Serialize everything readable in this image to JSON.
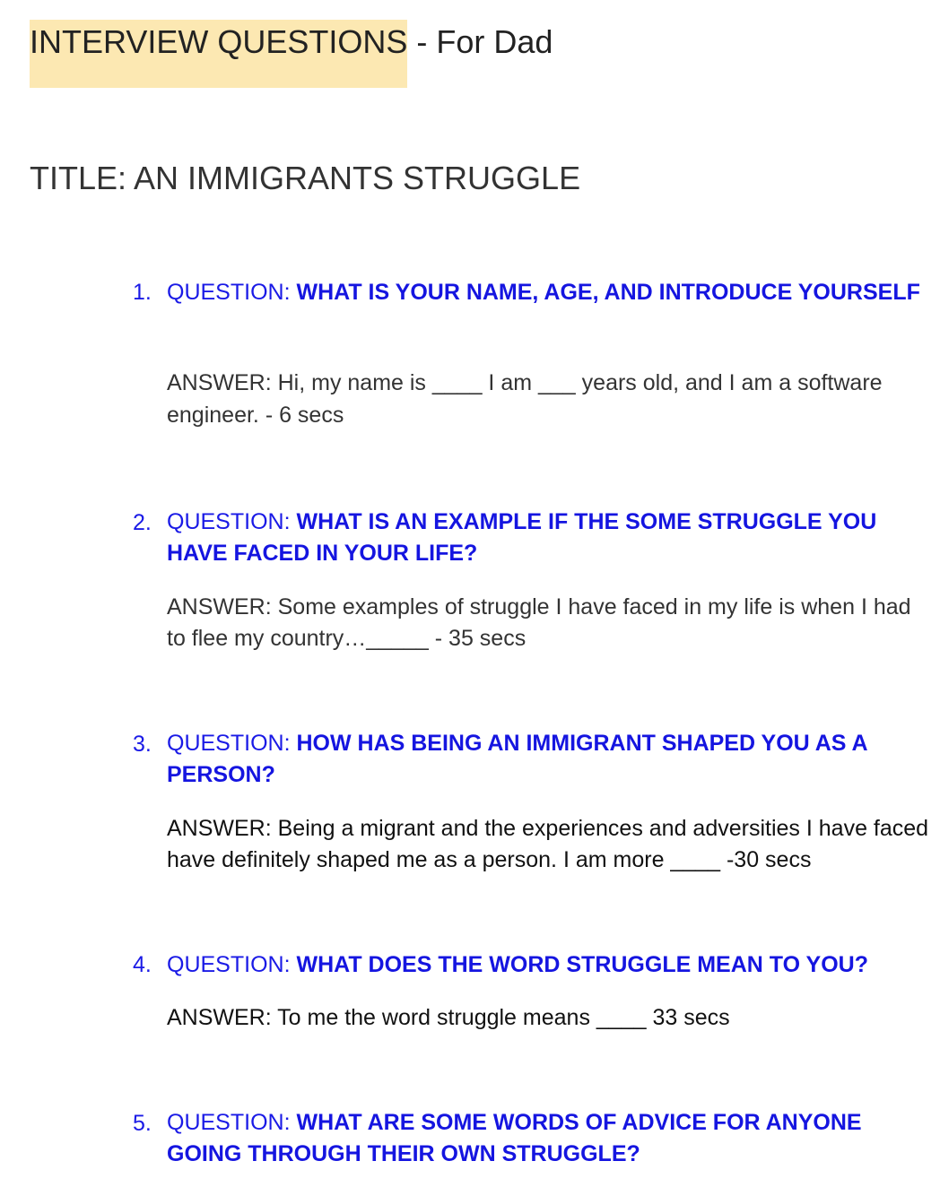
{
  "header": {
    "highlighted": "INTERVIEW QUESTIONS",
    "rest": " - For Dad"
  },
  "title": "TITLE: AN IMMIGRANTS STRUGGLE",
  "questions": [
    {
      "number": "1.",
      "lead": "QUESTION: ",
      "question": "WHAT IS YOUR NAME, AGE, AND INTRODUCE YOURSELF",
      "answer": "ANSWER: Hi, my name is ____ I am ___ years old, and I am a software engineer. - 6 secs"
    },
    {
      "number": "2.",
      "lead": "QUESTION: ",
      "question": "WHAT IS AN EXAMPLE IF THE SOME STRUGGLE YOU HAVE FACED IN YOUR LIFE?",
      "answer": "ANSWER: Some examples of struggle I have faced in my life is when I had to flee my country…_____ - 35 secs"
    },
    {
      "number": "3.",
      "lead": "QUESTION: ",
      "question": "HOW HAS BEING AN IMMIGRANT SHAPED YOU AS A PERSON?",
      "answer": "ANSWER: Being a migrant and the experiences and adversities I have faced have definitely shaped me as a person. I am more ____ -30 secs"
    },
    {
      "number": "4.",
      "lead": "QUESTION: ",
      "question": "WHAT DOES THE WORD STRUGGLE MEAN TO YOU?",
      "answer": "ANSWER: To me the word struggle means ____ 33 secs"
    },
    {
      "number": "5.",
      "lead": "QUESTION: ",
      "question": "WHAT ARE SOME WORDS OF ADVICE FOR ANYONE GOING THROUGH THEIR OWN STRUGGLE?"
    }
  ]
}
